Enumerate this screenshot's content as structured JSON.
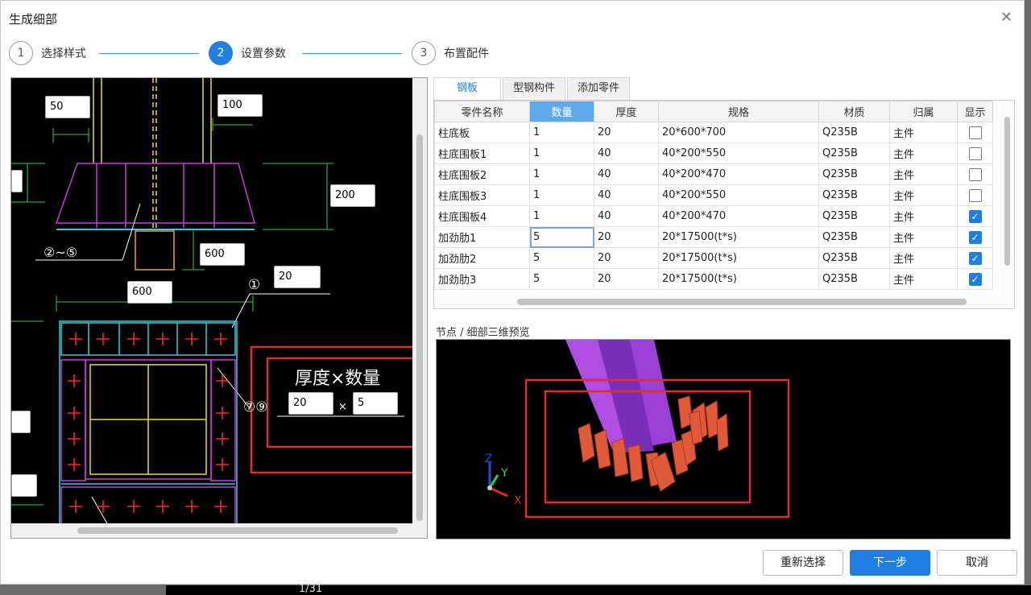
{
  "dialog": {
    "title": "生成细部",
    "close_glyph": "✕"
  },
  "steps": [
    {
      "num": "1",
      "label": "选择样式"
    },
    {
      "num": "2",
      "label": "设置参数"
    },
    {
      "num": "3",
      "label": "布置配件"
    }
  ],
  "cad": {
    "inputs": {
      "d50": "50",
      "d100": "100",
      "d200": "200",
      "d600a": "600",
      "d600b": "600",
      "d20": "20",
      "thickness": "20",
      "qty": "5"
    },
    "labels": {
      "ref_2_5": "②~⑤",
      "ref_1": "①",
      "ref_7_9": "⑦⑨",
      "thick_qty": "厚度×数量",
      "times": "×"
    }
  },
  "tabs": [
    "钢板",
    "型钢构件",
    "添加零件"
  ],
  "grid": {
    "columns": [
      "零件名称",
      "数量",
      "厚度",
      "规格",
      "材质",
      "归属",
      "显示"
    ],
    "rows": [
      {
        "name": "柱底板",
        "qty": "1",
        "thick": "20",
        "spec": "20*600*700",
        "mat": "Q235B",
        "owner": "主件",
        "show": false
      },
      {
        "name": "柱底围板1",
        "qty": "1",
        "thick": "40",
        "spec": "40*200*550",
        "mat": "Q235B",
        "owner": "主件",
        "show": false
      },
      {
        "name": "柱底围板2",
        "qty": "1",
        "thick": "40",
        "spec": "40*200*470",
        "mat": "Q235B",
        "owner": "主件",
        "show": false
      },
      {
        "name": "柱底围板3",
        "qty": "1",
        "thick": "40",
        "spec": "40*200*550",
        "mat": "Q235B",
        "owner": "主件",
        "show": false
      },
      {
        "name": "柱底围板4",
        "qty": "1",
        "thick": "40",
        "spec": "40*200*470",
        "mat": "Q235B",
        "owner": "主件",
        "show": true
      },
      {
        "name": "加劲肋1",
        "qty": "5",
        "thick": "20",
        "spec": "20*17500(t*s)",
        "mat": "Q235B",
        "owner": "主件",
        "show": true
      },
      {
        "name": "加劲肋2",
        "qty": "5",
        "thick": "20",
        "spec": "20*17500(t*s)",
        "mat": "Q235B",
        "owner": "主件",
        "show": true
      },
      {
        "name": "加劲肋3",
        "qty": "5",
        "thick": "20",
        "spec": "20*17500(t*s)",
        "mat": "Q235B",
        "owner": "主件",
        "show": true
      }
    ]
  },
  "preview": {
    "label": "节点 / 细部三维预览",
    "axis_x": "X",
    "axis_y": "Y",
    "axis_z": "Z"
  },
  "buttons": {
    "reselect": "重新选择",
    "next": "下一步",
    "cancel": "取消"
  },
  "background_text": "1/31",
  "colors": {
    "accent": "#1e7fe0",
    "highlight_frame": "#e82a2a",
    "rib": "#e05a3a",
    "column": "#9b3fd6"
  }
}
